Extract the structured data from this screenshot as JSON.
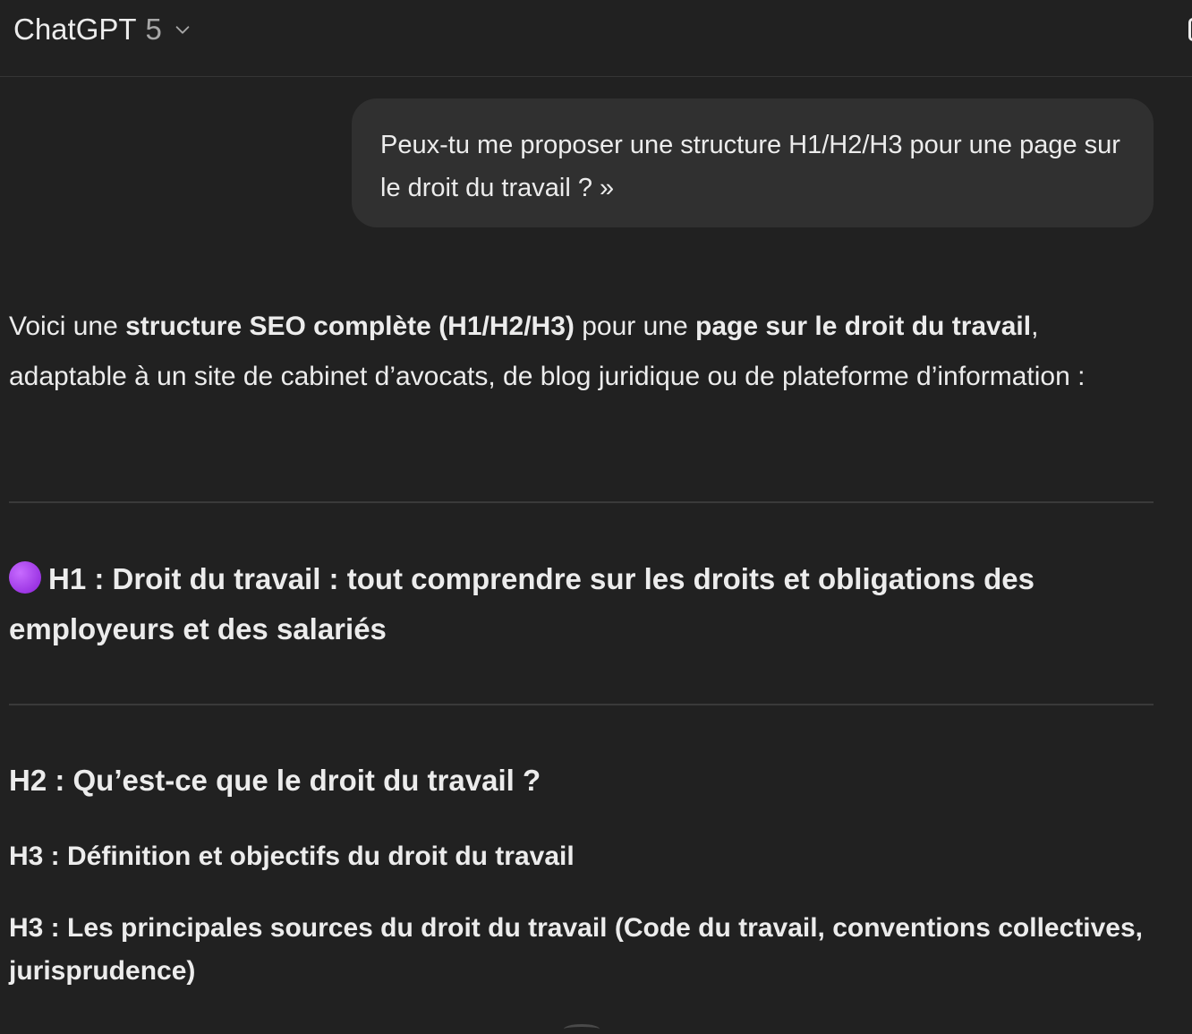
{
  "header": {
    "model_name": "ChatGPT",
    "model_version": "5",
    "icons": [
      "chevron-down-icon",
      "panel-icon"
    ]
  },
  "conversation": {
    "user_message": "Peux-tu me proposer une structure H1/H2/H3 pour une page sur le droit du travail ? »",
    "assistant": {
      "intro_p1": "Voici une ",
      "intro_b1": "structure SEO complète (H1/H2/H3)",
      "intro_p2": " pour une ",
      "intro_b2": "page sur le droit du travail",
      "intro_p3": ", adaptable à un site de cabinet d’avocats, de blog juridique ou de plateforme d’information :",
      "h1_emoji": "purple-circle-icon",
      "h1": "H1 : Droit du travail : tout comprendre sur les droits et obligations des employeurs et des salariés",
      "h2": "H2 : Qu’est-ce que le droit du travail ?",
      "h3_1": "H3 : Définition et objectifs du droit du travail",
      "h3_2": "H3 : Les principales sources du droit du travail (Code du travail, conventions collectives, jurisprudence)"
    }
  },
  "colors": {
    "background": "#212121",
    "bubble": "#303030",
    "text": "#ececec",
    "muted": "#a7a7a7",
    "accent_purple": "#9b30e8"
  }
}
